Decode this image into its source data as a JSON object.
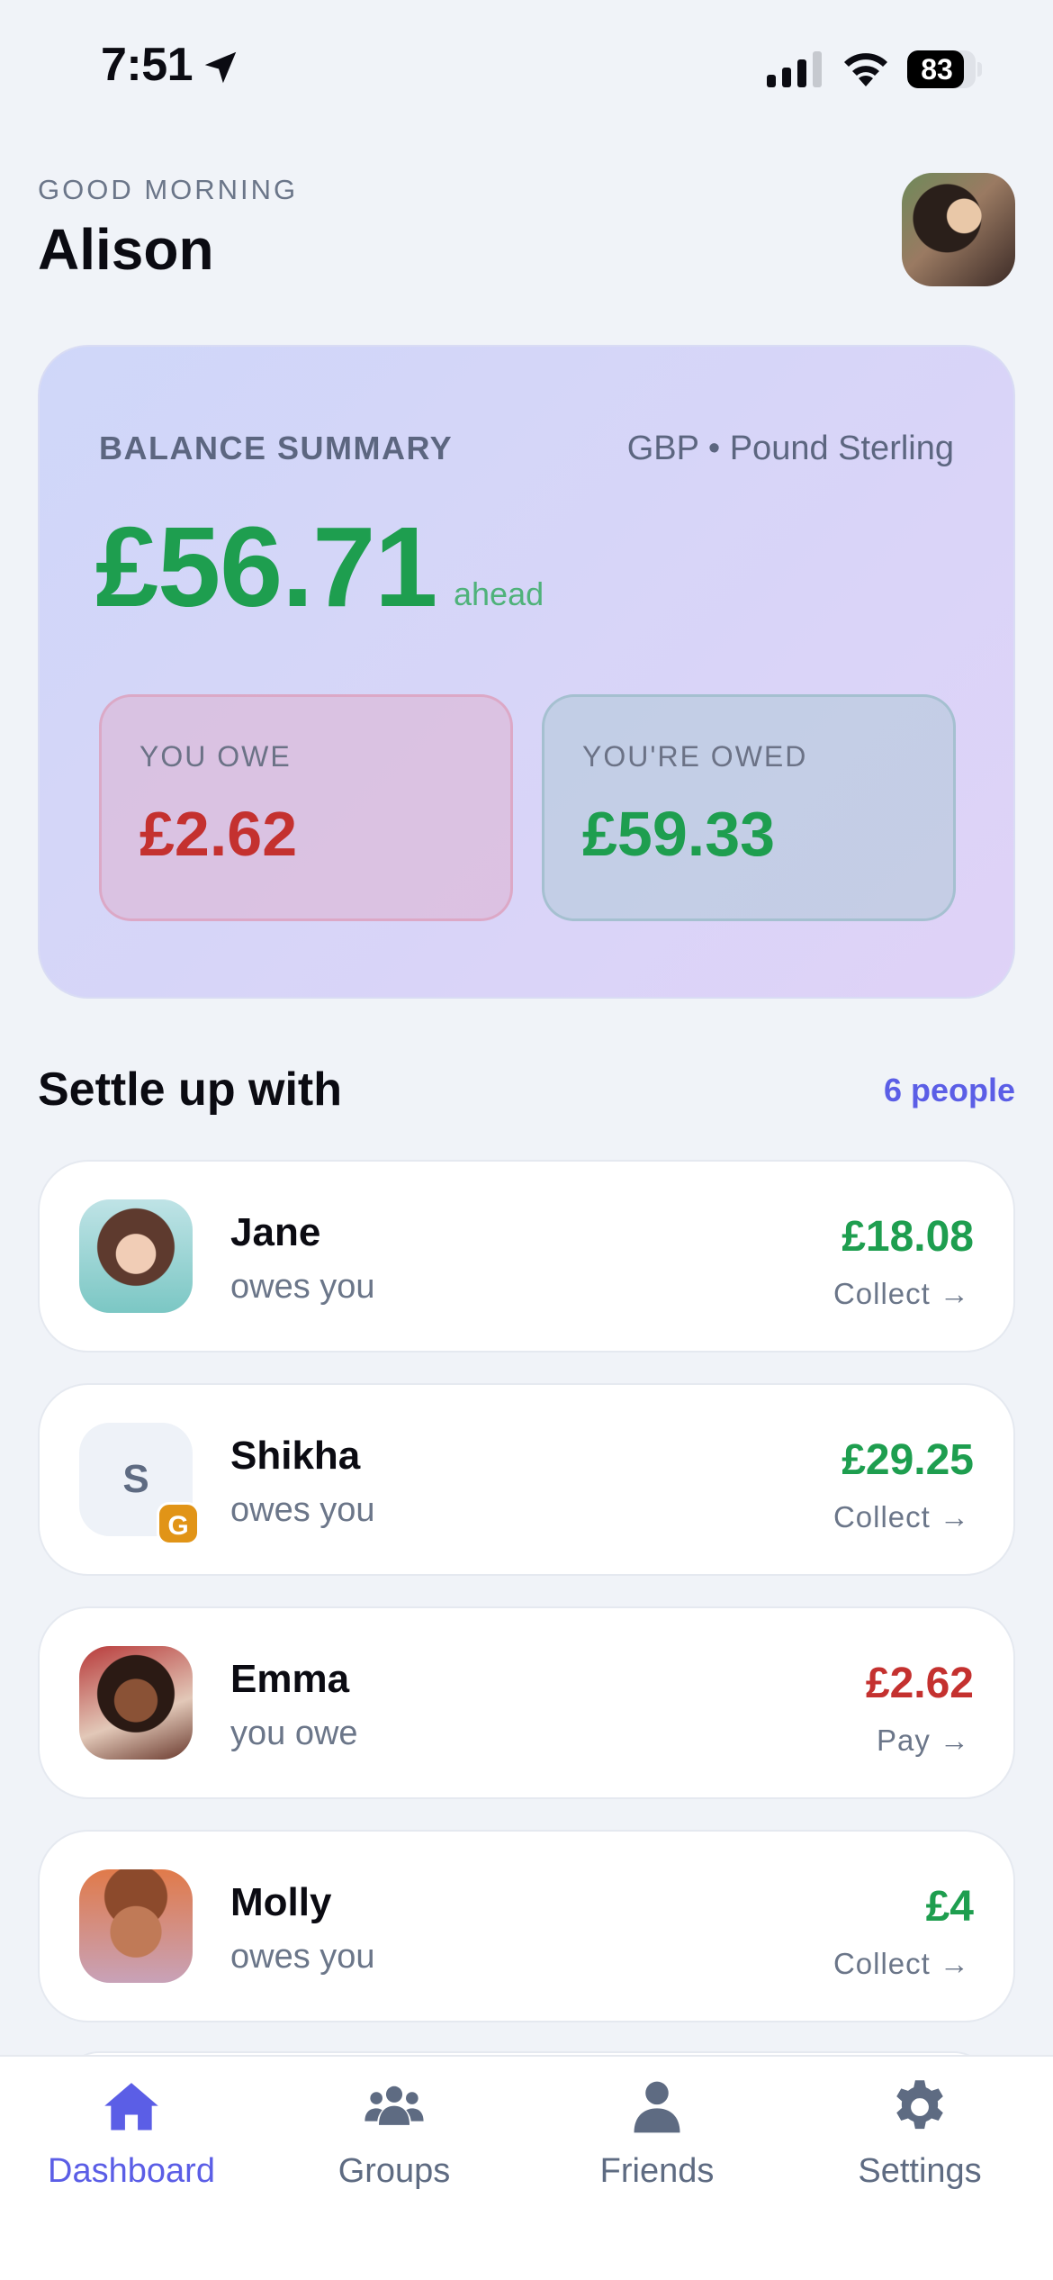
{
  "status_bar": {
    "time": "7:51",
    "battery": "83",
    "battery_percent": 83
  },
  "header": {
    "greeting": "GOOD MORNING",
    "name": "Alison"
  },
  "balance": {
    "label": "BALANCE SUMMARY",
    "currency": "GBP • Pound Sterling",
    "amount": "£56.71",
    "amount_note": "ahead",
    "you_owe_label": "YOU OWE",
    "you_owe_value": "£2.62",
    "owed_label": "YOU'RE OWED",
    "owed_value": "£59.33"
  },
  "settle": {
    "title": "Settle up with",
    "count": "6 people",
    "people": [
      {
        "name": "Jane",
        "status": "owes you",
        "amount": "£18.08",
        "action": "Collect →"
      },
      {
        "name": "Shikha",
        "initial": "S",
        "badge": "G",
        "status": "owes you",
        "amount": "£29.25",
        "action": "Collect →"
      },
      {
        "name": "Emma",
        "status": "you owe",
        "amount": "£2.62",
        "action": "Pay →"
      },
      {
        "name": "Molly",
        "status": "owes you",
        "amount": "£4",
        "action": "Collect →"
      }
    ]
  },
  "tabs": [
    {
      "label": "Dashboard",
      "icon": "home-icon",
      "active": true
    },
    {
      "label": "Groups",
      "icon": "group-icon"
    },
    {
      "label": "Friends",
      "icon": "person-icon"
    },
    {
      "label": "Settings",
      "icon": "gear-icon"
    }
  ],
  "colors": {
    "accent": "#5b5ee6",
    "positive": "#1e9e4f",
    "negative": "#c4312f",
    "badge": "#e19417"
  }
}
